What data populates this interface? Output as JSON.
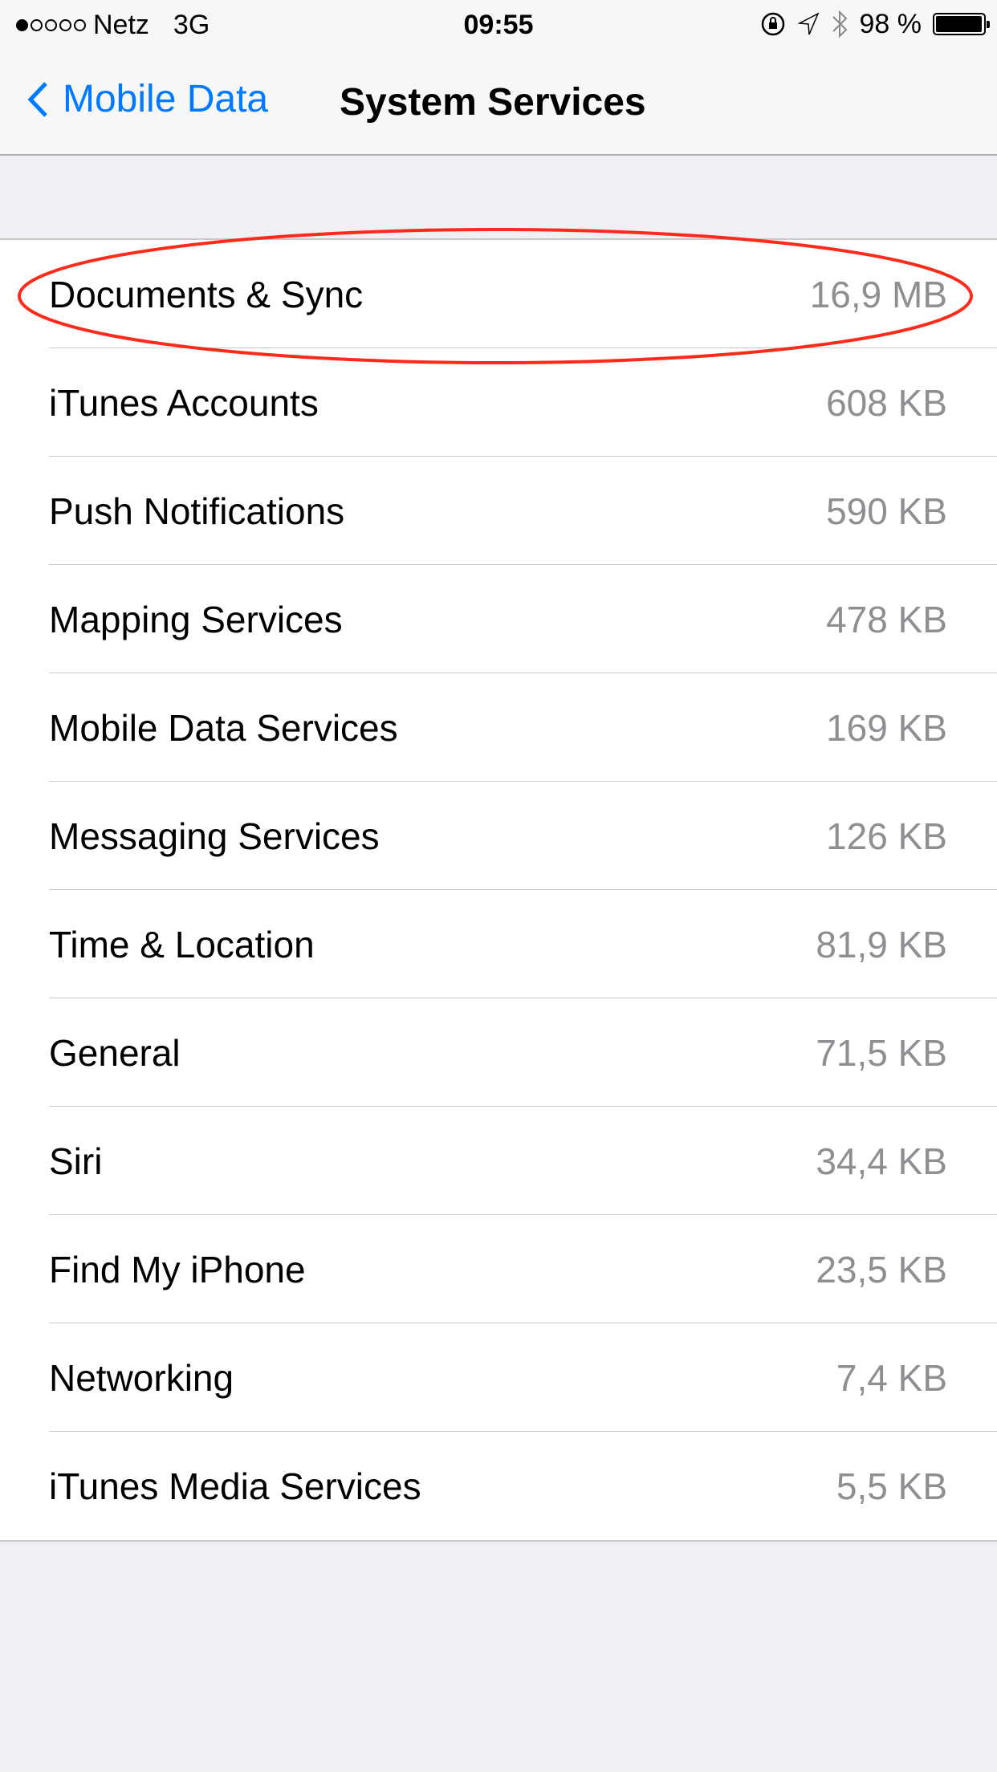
{
  "status_bar": {
    "signal_filled": 1,
    "signal_total": 5,
    "carrier": "Netz",
    "network": "3G",
    "time": "09:55",
    "battery_percent": "98 %",
    "battery_level": 0.98,
    "icons": [
      "rotation-lock-icon",
      "location-icon",
      "bluetooth-icon",
      "battery-icon"
    ]
  },
  "nav": {
    "back_label": "Mobile Data",
    "title": "System Services"
  },
  "accent_color": "#007aff",
  "annotation_color": "#ff2a1a",
  "items": [
    {
      "name": "Documents & Sync",
      "value": "16,9 MB",
      "highlighted": true
    },
    {
      "name": "iTunes Accounts",
      "value": "608 KB"
    },
    {
      "name": "Push Notifications",
      "value": "590 KB"
    },
    {
      "name": "Mapping Services",
      "value": "478 KB"
    },
    {
      "name": "Mobile Data Services",
      "value": "169 KB"
    },
    {
      "name": "Messaging Services",
      "value": "126 KB"
    },
    {
      "name": "Time & Location",
      "value": "81,9 KB"
    },
    {
      "name": "General",
      "value": "71,5 KB"
    },
    {
      "name": "Siri",
      "value": "34,4 KB"
    },
    {
      "name": "Find My iPhone",
      "value": "23,5 KB"
    },
    {
      "name": "Networking",
      "value": "7,4 KB"
    },
    {
      "name": "iTunes Media Services",
      "value": "5,5 KB"
    }
  ]
}
